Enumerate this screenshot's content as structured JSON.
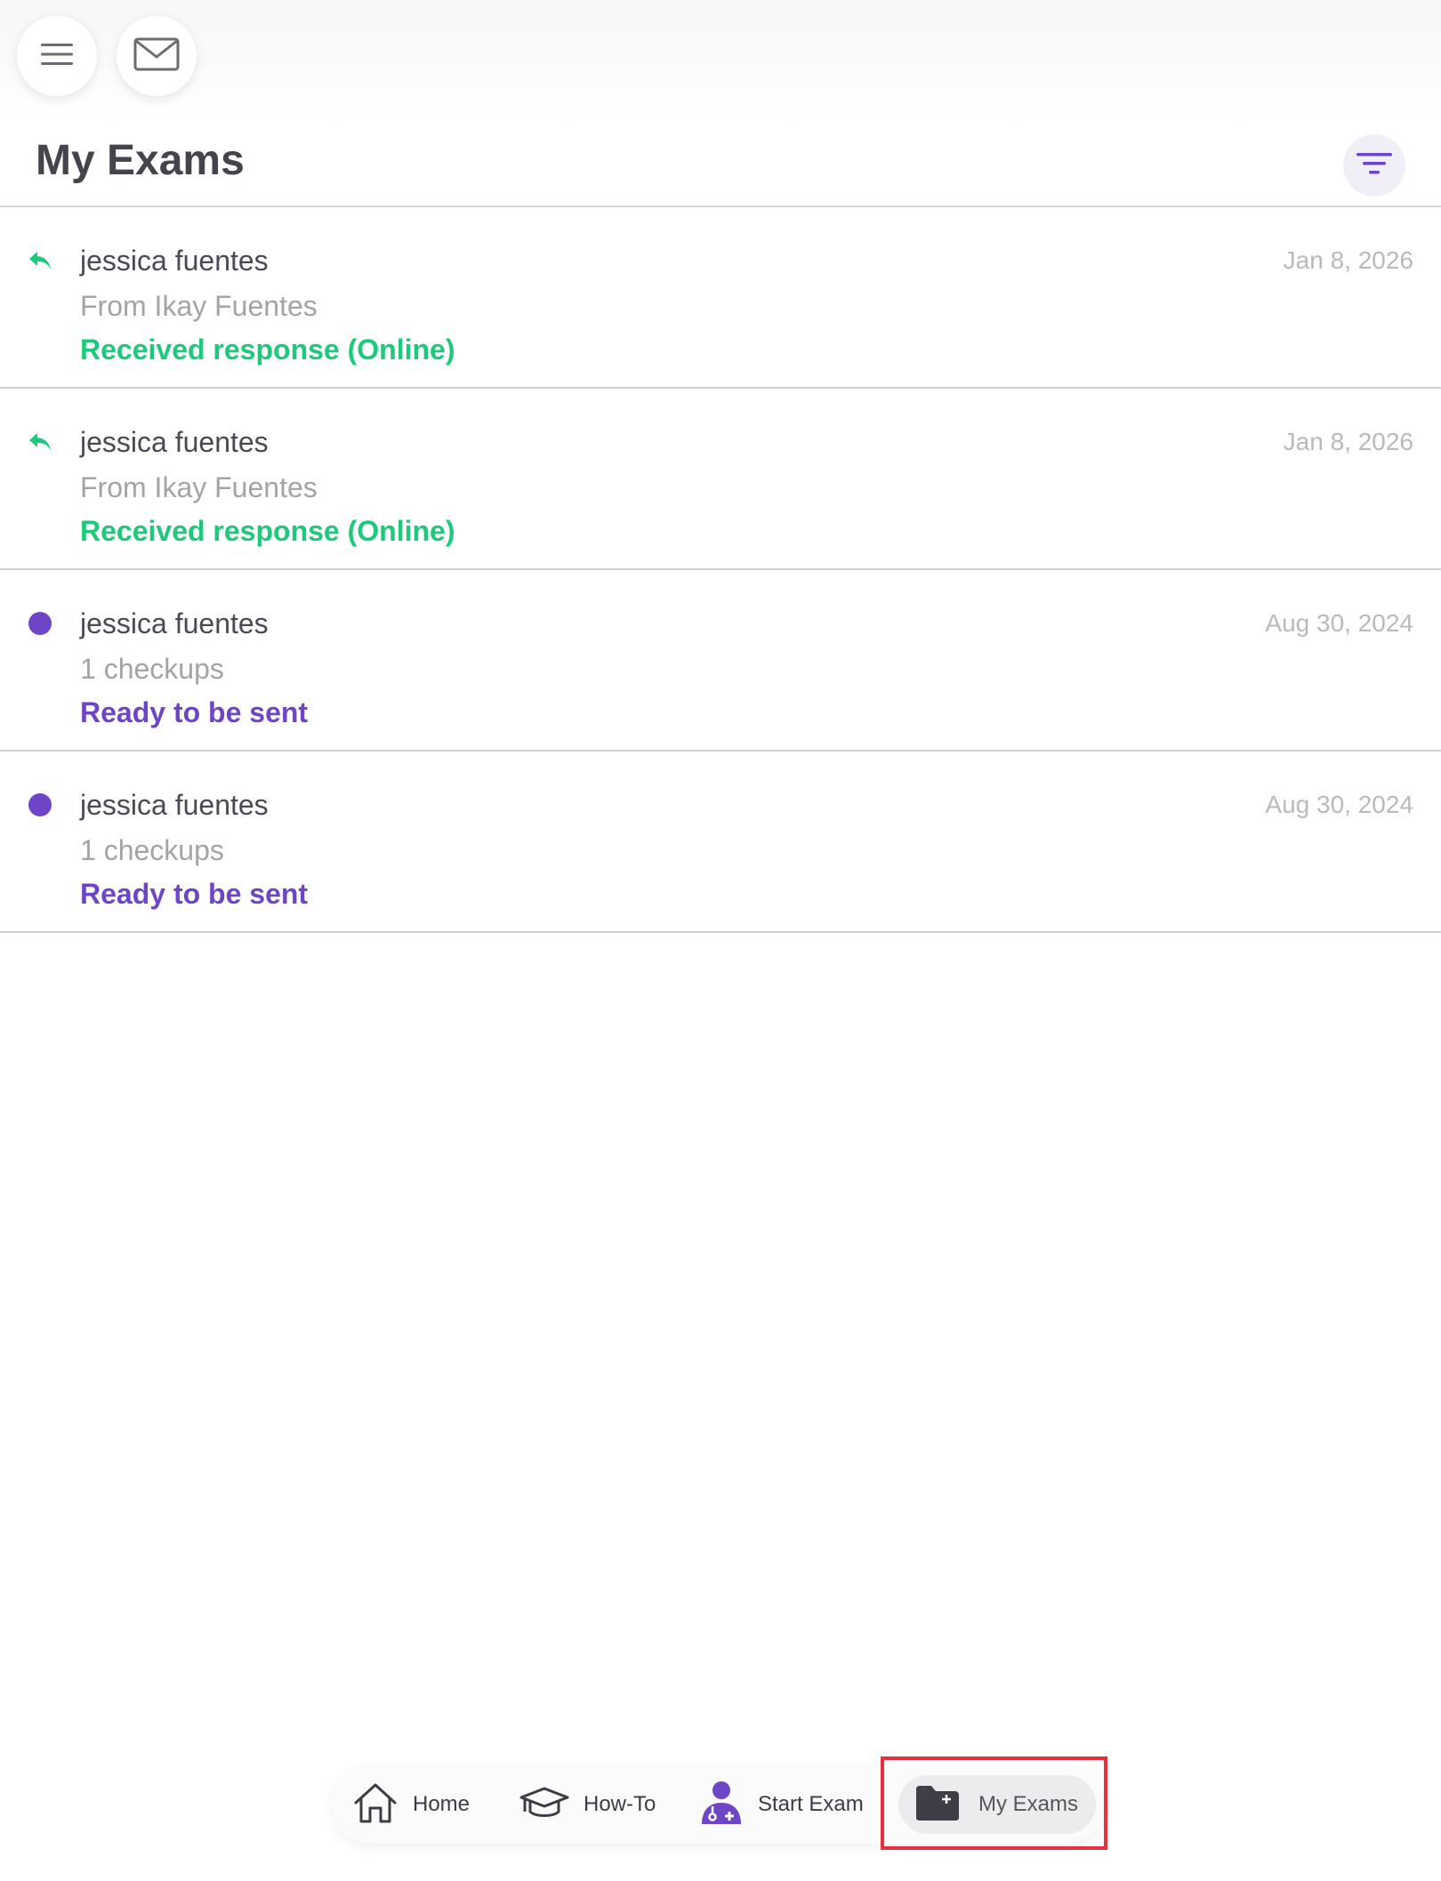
{
  "header": {
    "menu_icon": "hamburger-menu-icon",
    "mail_icon": "envelope-icon",
    "title": "My Exams",
    "filter_icon": "filter-icon"
  },
  "colors": {
    "received": "#1dc97a",
    "ready": "#6d45c6",
    "title": "#44444d",
    "highlight": "#e6313d"
  },
  "exams": [
    {
      "status_icon": "reply-arrow-icon",
      "name": "jessica fuentes",
      "subtitle": "From Ikay Fuentes",
      "status": "Received response (Online)",
      "status_type": "received",
      "date": "Jan 8, 2026"
    },
    {
      "status_icon": "reply-arrow-icon",
      "name": "jessica fuentes",
      "subtitle": "From Ikay Fuentes",
      "status": "Received response (Online)",
      "status_type": "received",
      "date": "Jan 8, 2026"
    },
    {
      "status_icon": "purple-dot-icon",
      "name": "jessica fuentes",
      "subtitle": "1 checkups",
      "status": "Ready to be sent",
      "status_type": "ready",
      "date": "Aug 30, 2024"
    },
    {
      "status_icon": "purple-dot-icon",
      "name": "jessica fuentes",
      "subtitle": "1 checkups",
      "status": "Ready to be sent",
      "status_type": "ready",
      "date": "Aug 30, 2024"
    }
  ],
  "nav": {
    "home": {
      "label": "Home",
      "icon": "home-icon"
    },
    "howto": {
      "label": "How-To",
      "icon": "graduation-cap-icon"
    },
    "start": {
      "label": "Start Exam",
      "icon": "doctor-icon"
    },
    "myexams": {
      "label": "My Exams",
      "icon": "folder-plus-icon",
      "active": true
    }
  }
}
